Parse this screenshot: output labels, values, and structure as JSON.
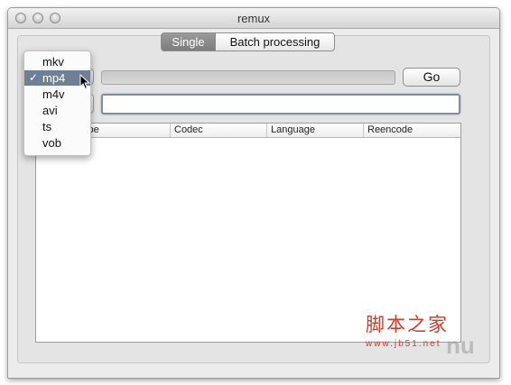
{
  "window": {
    "title": "remux"
  },
  "tabs": [
    {
      "label": "Single",
      "selected": true
    },
    {
      "label": "Batch processing",
      "selected": false
    }
  ],
  "toolbar": {
    "go_label": "Go",
    "progress": 0
  },
  "path_field": {
    "value": ""
  },
  "format_menu": {
    "items": [
      "mkv",
      "mp4",
      "m4v",
      "avi",
      "ts",
      "vob"
    ],
    "selected": "mp4",
    "check": "✓"
  },
  "table": {
    "columns": [
      "Type",
      "Codec",
      "Language",
      "Reencode"
    ],
    "visible_first_column": "ype"
  },
  "watermark": {
    "cn": "脚本之家",
    "url": "www.jb51.net"
  },
  "colors": {
    "selection": "#6e7f96",
    "watermark": "#d03a2a"
  }
}
